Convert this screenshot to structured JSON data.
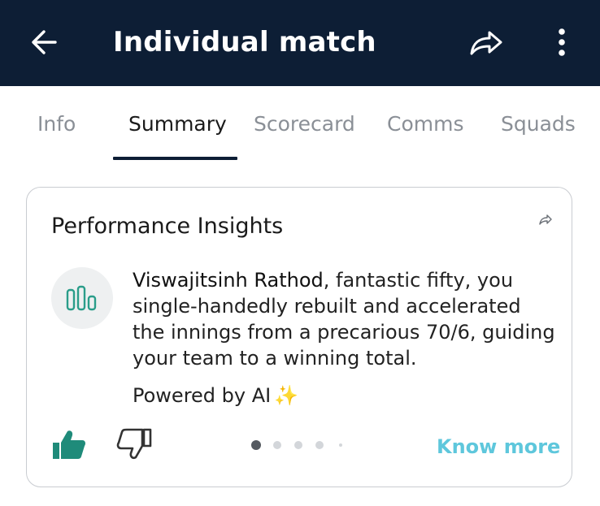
{
  "header": {
    "title": "Individual match",
    "back_icon": "arrow-left-icon",
    "share_icon": "share-icon",
    "more_icon": "more-vertical-icon"
  },
  "tabs": [
    {
      "label": "Info",
      "active": false
    },
    {
      "label": "Summary",
      "active": true
    },
    {
      "label": "Scorecard",
      "active": false
    },
    {
      "label": "Comms",
      "active": false
    },
    {
      "label": "Squads",
      "active": false
    }
  ],
  "insights": {
    "heading": "Performance Insights",
    "player_name": "Viswajitsinh Rathod",
    "message": ", fantastic fifty, you single-handedly rebuilt and accelerated the innings from a precarious 70/6, guiding your team to a winning total.",
    "powered_by": "Powered by AI",
    "sparkle_icon": "sparkles-icon",
    "feedback": {
      "liked": true,
      "disliked": false
    },
    "carousel": {
      "total_pages": 5,
      "current_page": 1
    },
    "know_more_label": "Know more"
  },
  "colors": {
    "header_bg": "#0d1e35",
    "accent_teal": "#1f8b7a",
    "link_cyan": "#5ec7dc",
    "inactive_tab": "#8a8f96"
  }
}
